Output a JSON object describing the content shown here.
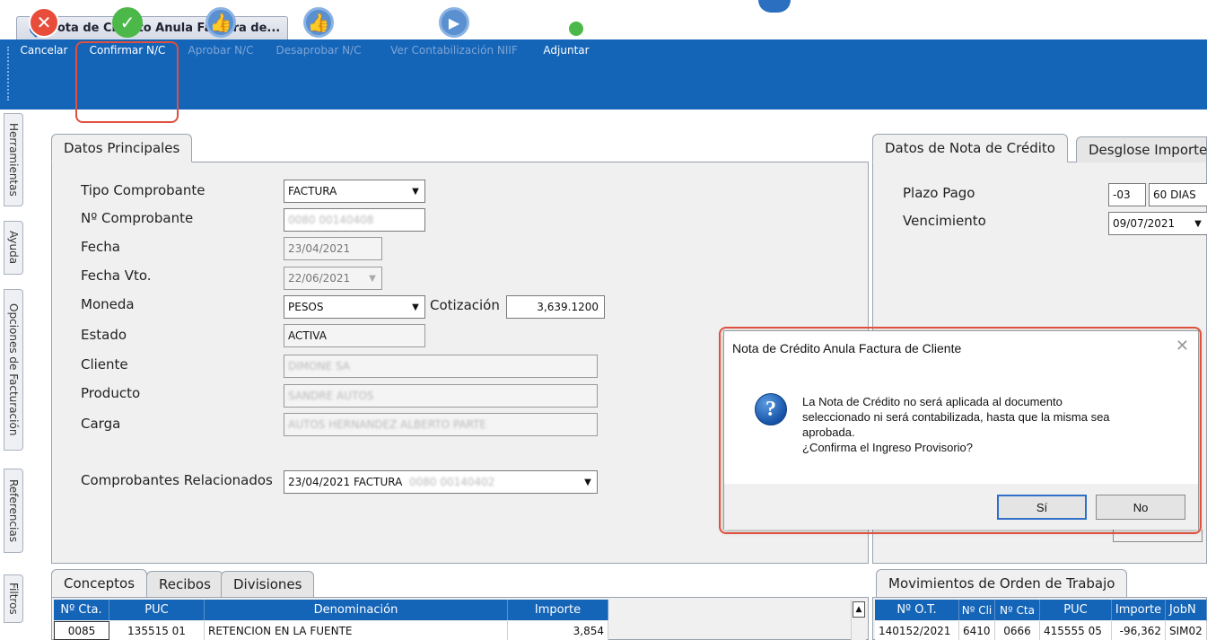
{
  "window": {
    "tab_title": "Nota de Crédito Anula Factura de..."
  },
  "toolbar": {
    "buttons": [
      {
        "label": "Cancelar",
        "icon": "cancel-icon",
        "enabled": true
      },
      {
        "label": "Confirmar N/C",
        "icon": "check-icon",
        "enabled": true
      },
      {
        "label": "Aprobar N/C",
        "icon": "thumbs-up-icon",
        "enabled": false
      },
      {
        "label": "Desaprobar N/C",
        "icon": "thumbs-down-icon",
        "enabled": false
      },
      {
        "label": "Ver Contabilización NIIF",
        "icon": "play-icon",
        "enabled": false
      },
      {
        "label": "Adjuntar",
        "icon": "attach-document-icon",
        "enabled": true
      }
    ]
  },
  "side_tabs": [
    "Herramientas",
    "Ayuda",
    "Opciones de Facturación",
    "Referencias",
    "Filtros"
  ],
  "main_panel": {
    "tab": "Datos Principales",
    "fields": {
      "tipo_comprobante": {
        "label": "Tipo Comprobante",
        "value": "FACTURA"
      },
      "nro_comprobante": {
        "label": "Nº Comprobante",
        "value": "0080 00140408"
      },
      "fecha": {
        "label": "Fecha",
        "value": "23/04/2021"
      },
      "fecha_vto": {
        "label": "Fecha Vto.",
        "value": "22/06/2021"
      },
      "moneda": {
        "label": "Moneda",
        "value": "PESOS"
      },
      "cotizacion": {
        "label": "Cotización",
        "value": "3,639.1200"
      },
      "estado": {
        "label": "Estado",
        "value": "ACTIVA"
      },
      "cliente": {
        "label": "Cliente",
        "value": "DIMONE SA"
      },
      "producto": {
        "label": "Producto",
        "value": "SANDRE AUTOS"
      },
      "carga": {
        "label": "Carga",
        "value": "AUTOS HERNANDEZ ALBERTO PARTE"
      },
      "comprobantes_relacionados": {
        "label": "Comprobantes Relacionados",
        "value": "23/04/2021 FACTURA",
        "value_blurred": "0080 00140402"
      }
    }
  },
  "right_panel": {
    "tabs": [
      "Datos de Nota de Crédito",
      "Desglose Importe"
    ],
    "plazo_pago": {
      "label": "Plazo Pago",
      "code": "-03",
      "value": "60 DIAS"
    },
    "vencimiento": {
      "label": "Vencimiento",
      "value": "09/07/2021"
    }
  },
  "bottom_left": {
    "tabs": [
      "Conceptos",
      "Recibos",
      "Divisiones"
    ],
    "columns": [
      "Nº Cta.",
      "PUC",
      "Denominación",
      "Importe"
    ],
    "rows": [
      {
        "cta": "0085",
        "puc": "135515 01",
        "denominacion": "RETENCION EN LA FUENTE",
        "importe": "3,854"
      }
    ]
  },
  "bottom_right": {
    "tab": "Movimientos de Orden de Trabajo",
    "columns": [
      "Nº O.T.",
      "Nº Cli",
      "Nº Cta",
      "PUC",
      "Importe",
      "JobN"
    ],
    "rows": [
      {
        "ot": "140152/2021",
        "cli": "6410",
        "cta": "0666",
        "puc": "415555 05",
        "importe": "-96,362",
        "job": "SIM02"
      }
    ]
  },
  "dialog": {
    "title": "Nota de Crédito Anula Factura de Cliente",
    "message_lines": [
      "La Nota de Crédito no será aplicada al documento",
      "seleccionado ni será contabilizada, hasta que la misma sea",
      "aprobada.",
      "¿Confirma el Ingreso Provisorio?"
    ],
    "yes_label": "Sí",
    "no_label": "No"
  },
  "colors": {
    "toolbar_bg": "#1464b8",
    "highlight": "#e0503c",
    "cancel_red": "#e84d3c",
    "confirm_green": "#4cb84a"
  }
}
